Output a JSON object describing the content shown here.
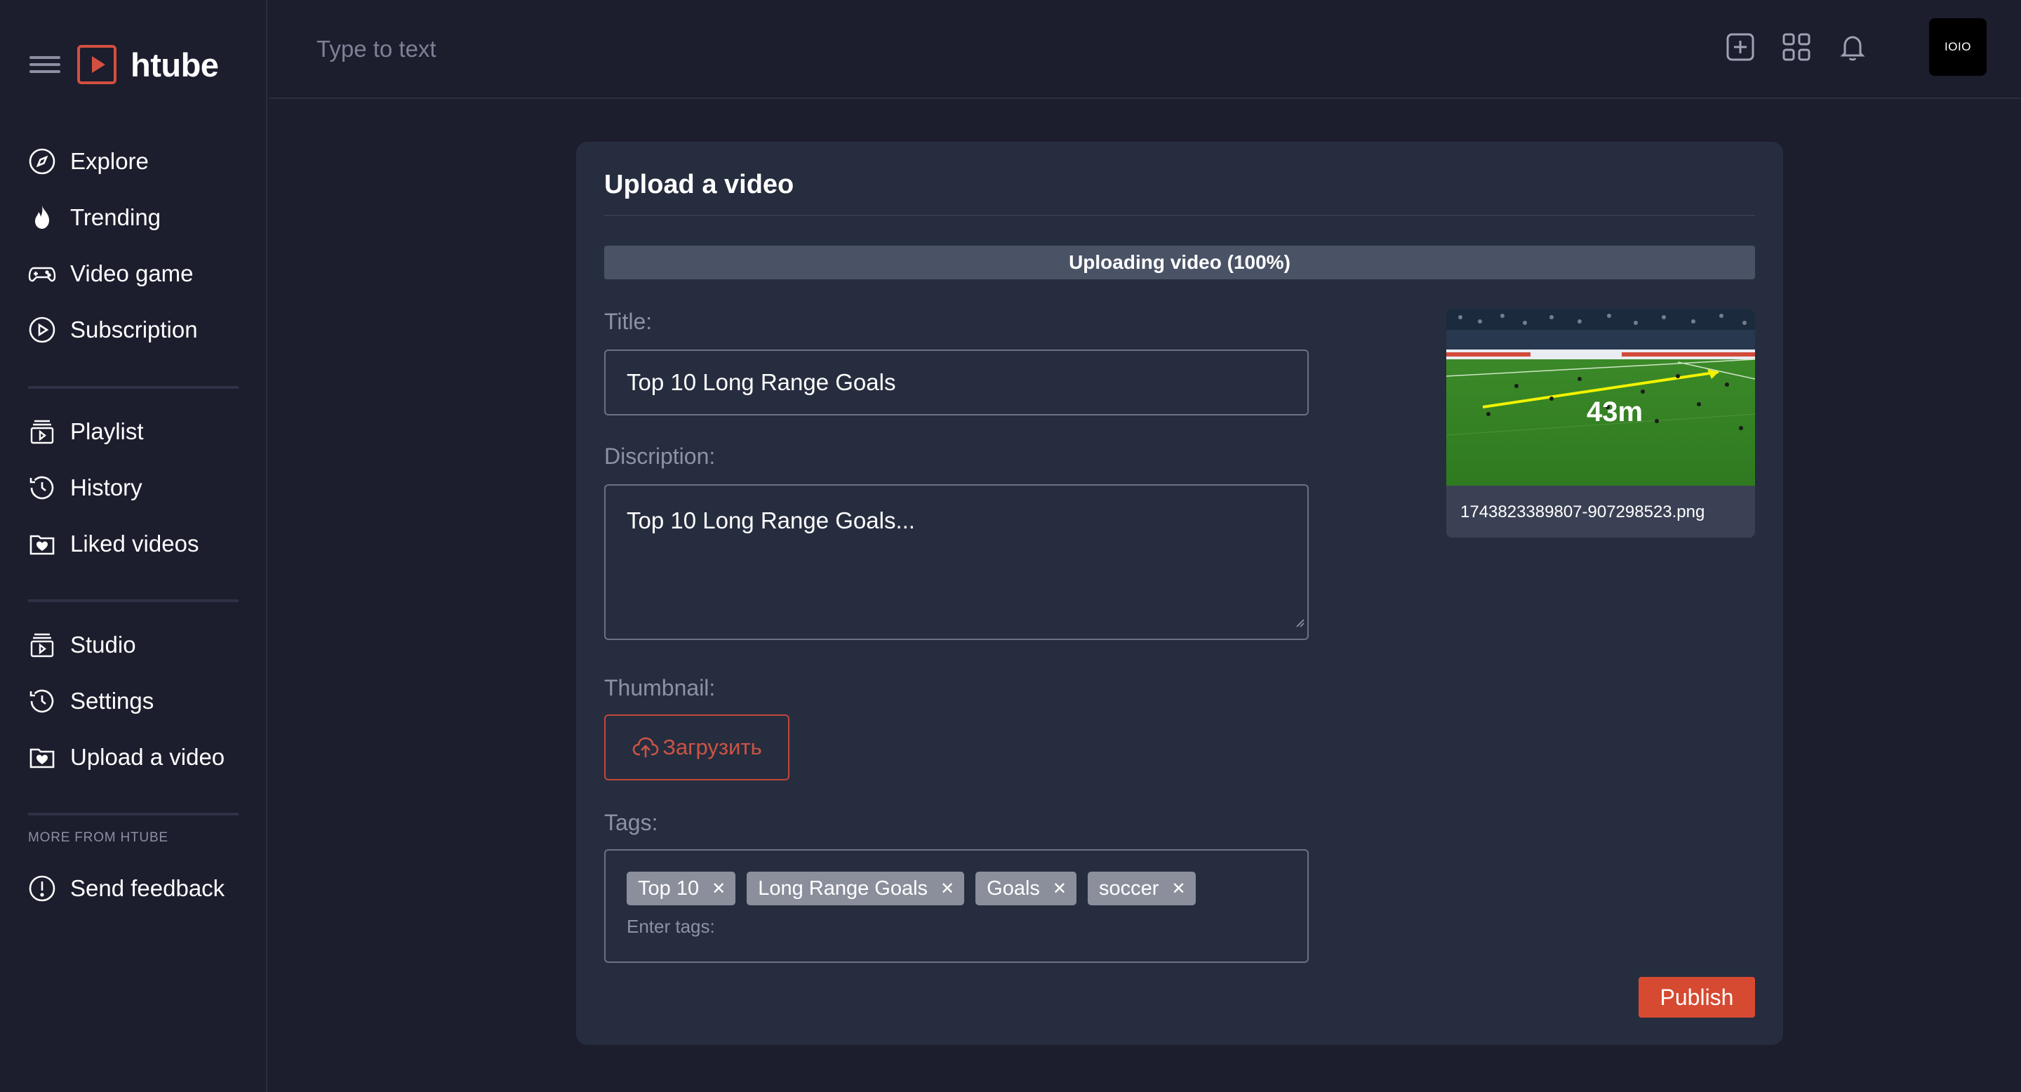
{
  "brand": {
    "name": "htube",
    "accent": "#d2503f"
  },
  "header": {
    "search_placeholder": "Type to text",
    "icons": [
      "add-square-icon",
      "grid-icon",
      "bell-icon"
    ],
    "avatar_text": "IOIO"
  },
  "sidebar": {
    "main": [
      {
        "label": "Explore",
        "icon": "compass-icon"
      },
      {
        "label": "Trending",
        "icon": "flame-icon"
      },
      {
        "label": "Video game",
        "icon": "gamepad-icon"
      },
      {
        "label": "Subscription",
        "icon": "play-circle-icon"
      }
    ],
    "library": [
      {
        "label": "Playlist",
        "icon": "playlist-icon"
      },
      {
        "label": "History",
        "icon": "history-icon"
      },
      {
        "label": "Liked videos",
        "icon": "heart-folder-icon"
      }
    ],
    "studio": [
      {
        "label": "Studio",
        "icon": "playlist-icon"
      },
      {
        "label": "Settings",
        "icon": "history-icon"
      },
      {
        "label": "Upload a video",
        "icon": "heart-folder-icon"
      }
    ],
    "more_label": "MORE FROM HTUBE",
    "feedback": {
      "label": "Send feedback",
      "icon": "alert-circle-icon"
    }
  },
  "upload": {
    "title": "Upload a video",
    "progress_text": "Uploading video (100%)",
    "progress_percent": 100,
    "title_label": "Title:",
    "title_value": "Top 10 Long Range Goals",
    "description_label": "Discription:",
    "description_value": "Top 10 Long Range Goals...",
    "thumbnail_label": "Thumbnail:",
    "thumbnail_button": "Загрузить",
    "tags_label": "Tags:",
    "tags": [
      "Top 10",
      "Long Range Goals",
      "Goals",
      "soccer"
    ],
    "tags_placeholder": "Enter tags:",
    "preview_overlay": "43m",
    "preview_filename": "1743823389807-907298523.png",
    "publish_label": "Publish"
  }
}
